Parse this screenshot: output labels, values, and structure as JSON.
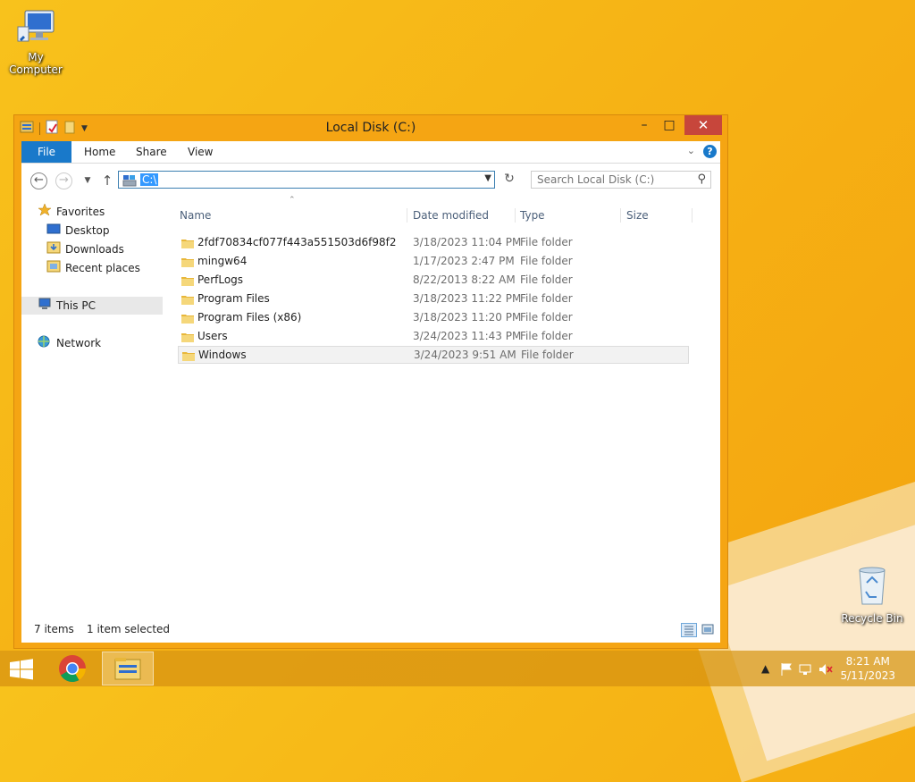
{
  "desktop": {
    "icons": [
      {
        "label": "My Computer"
      },
      {
        "label": "Recycle Bin"
      }
    ]
  },
  "window": {
    "title": "Local Disk (C:)",
    "controls": {
      "minimize": "–",
      "maximize": "□",
      "close": "✕"
    }
  },
  "ribbon": {
    "tabs": [
      "File",
      "Home",
      "Share",
      "View"
    ],
    "help": "?"
  },
  "nav": {
    "address_value": "C:\\",
    "search_placeholder": "Search Local Disk (C:)"
  },
  "navpane": {
    "favorites": "Favorites",
    "desktop": "Desktop",
    "downloads": "Downloads",
    "recent": "Recent places",
    "this_pc": "This PC",
    "network": "Network"
  },
  "columns": {
    "name": "Name",
    "date": "Date modified",
    "type": "Type",
    "size": "Size"
  },
  "files": [
    {
      "name": "2fdf70834cf077f443a551503d6f98f2",
      "date": "3/18/2023 11:04 PM",
      "type": "File folder"
    },
    {
      "name": "mingw64",
      "date": "1/17/2023 2:47 PM",
      "type": "File folder"
    },
    {
      "name": "PerfLogs",
      "date": "8/22/2013 8:22 AM",
      "type": "File folder"
    },
    {
      "name": "Program Files",
      "date": "3/18/2023 11:22 PM",
      "type": "File folder"
    },
    {
      "name": "Program Files (x86)",
      "date": "3/18/2023 11:20 PM",
      "type": "File folder"
    },
    {
      "name": "Users",
      "date": "3/24/2023 11:43 PM",
      "type": "File folder"
    },
    {
      "name": "Windows",
      "date": "3/24/2023 9:51 AM",
      "type": "File folder"
    }
  ],
  "status": {
    "count": "7 items",
    "selection": "1 item selected"
  },
  "taskbar": {
    "time": "8:21 AM",
    "date": "5/11/2023"
  },
  "colors": {
    "accent": "#1979ca",
    "close": "#c7463b",
    "selection": "#3399ff",
    "desktop": "#f6b315"
  },
  "icons": [
    "computer-icon",
    "recycle-bin-icon",
    "folder-icon",
    "star-icon",
    "desktop-icon",
    "downloads-icon",
    "recent-places-icon",
    "this-pc-icon",
    "network-icon",
    "windows-logo-icon",
    "chrome-icon",
    "file-explorer-icon",
    "flag-icon",
    "network-tray-icon",
    "volume-muted-icon"
  ]
}
